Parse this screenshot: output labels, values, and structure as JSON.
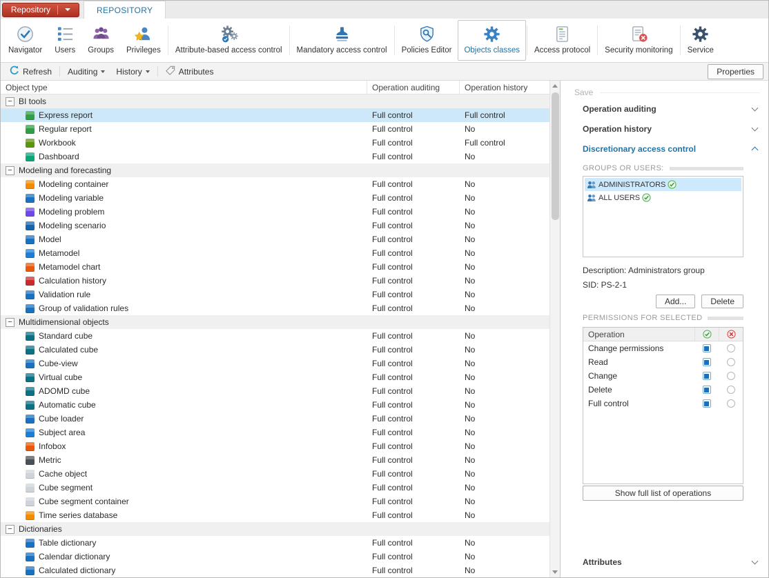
{
  "app": {
    "menu_button_label": "Repository",
    "active_tab": "REPOSITORY"
  },
  "colors": {
    "brand_red": "#b4402e",
    "accent_blue": "#2471a3",
    "selection_blue": "#cde8f9",
    "check_green": "#5cb85c",
    "cross_red": "#d9534f"
  },
  "ribbon": {
    "items": [
      {
        "label": "Navigator",
        "icon": "navigator-icon"
      },
      {
        "label": "Users",
        "icon": "users-icon"
      },
      {
        "label": "Groups",
        "icon": "groups-icon"
      },
      {
        "label": "Privileges",
        "icon": "privileges-icon"
      },
      {
        "label": "Attribute-based access control",
        "icon": "attribute-access-icon"
      },
      {
        "label": "Mandatory access control",
        "icon": "mandatory-access-icon"
      },
      {
        "label": "Policies Editor",
        "icon": "policies-editor-icon"
      },
      {
        "label": "Objects classes",
        "icon": "objects-classes-icon",
        "selected": true
      },
      {
        "label": "Access protocol",
        "icon": "access-protocol-icon"
      },
      {
        "label": "Security monitoring",
        "icon": "security-monitoring-icon"
      },
      {
        "label": "Service",
        "icon": "service-icon"
      }
    ]
  },
  "toolbar": {
    "refresh_label": "Refresh",
    "auditing_label": "Auditing",
    "history_label": "History",
    "attributes_label": "Attributes",
    "properties_label": "Properties"
  },
  "object_table": {
    "columns": [
      "Object type",
      "Operation auditing",
      "Operation history"
    ],
    "rows": [
      {
        "cls": "group",
        "label": "BI tools"
      },
      {
        "cls": "item selected",
        "label": "Express report",
        "auditing": "Full control",
        "history": "Full control",
        "icon_color": "#2f9e44"
      },
      {
        "cls": "item",
        "label": "Regular report",
        "auditing": "Full control",
        "history": "No",
        "icon_color": "#2f9e44"
      },
      {
        "cls": "item",
        "label": "Workbook",
        "auditing": "Full control",
        "history": "Full control",
        "icon_color": "#5c940d"
      },
      {
        "cls": "item",
        "label": "Dashboard",
        "auditing": "Full control",
        "history": "No",
        "icon_color": "#0ca678"
      },
      {
        "cls": "group",
        "label": "Modeling and forecasting"
      },
      {
        "cls": "item",
        "label": "Modeling container",
        "auditing": "Full control",
        "history": "No",
        "icon_color": "#f08c00"
      },
      {
        "cls": "item",
        "label": "Modeling variable",
        "auditing": "Full control",
        "history": "No",
        "icon_color": "#1971c2"
      },
      {
        "cls": "item",
        "label": "Modeling problem",
        "auditing": "Full control",
        "history": "No",
        "icon_color": "#7048e8"
      },
      {
        "cls": "item",
        "label": "Modeling scenario",
        "auditing": "Full control",
        "history": "No",
        "icon_color": "#1864ab"
      },
      {
        "cls": "item",
        "label": "Model",
        "auditing": "Full control",
        "history": "No",
        "icon_color": "#1971c2"
      },
      {
        "cls": "item",
        "label": "Metamodel",
        "auditing": "Full control",
        "history": "No",
        "icon_color": "#1c7ed6"
      },
      {
        "cls": "item",
        "label": "Metamodel chart",
        "auditing": "Full control",
        "history": "No",
        "icon_color": "#e8590c"
      },
      {
        "cls": "item",
        "label": "Calculation history",
        "auditing": "Full control",
        "history": "No",
        "icon_color": "#c92a2a"
      },
      {
        "cls": "item",
        "label": "Validation rule",
        "auditing": "Full control",
        "history": "No",
        "icon_color": "#1971c2"
      },
      {
        "cls": "item",
        "label": "Group of validation rules",
        "auditing": "Full control",
        "history": "No",
        "icon_color": "#1971c2"
      },
      {
        "cls": "group",
        "label": "Multidimensional objects"
      },
      {
        "cls": "item",
        "label": "Standard cube",
        "auditing": "Full control",
        "history": "No",
        "icon_color": "#0b7285"
      },
      {
        "cls": "item",
        "label": "Calculated cube",
        "auditing": "Full control",
        "history": "No",
        "icon_color": "#0b7285"
      },
      {
        "cls": "item",
        "label": "Cube-view",
        "auditing": "Full control",
        "history": "No",
        "icon_color": "#1971c2"
      },
      {
        "cls": "item",
        "label": "Virtual cube",
        "auditing": "Full control",
        "history": "No",
        "icon_color": "#0b7285"
      },
      {
        "cls": "item",
        "label": "ADOMD cube",
        "auditing": "Full control",
        "history": "No",
        "icon_color": "#0b7285"
      },
      {
        "cls": "item",
        "label": "Automatic cube",
        "auditing": "Full control",
        "history": "No",
        "icon_color": "#0b7285"
      },
      {
        "cls": "item",
        "label": "Cube loader",
        "auditing": "Full control",
        "history": "No",
        "icon_color": "#1971c2"
      },
      {
        "cls": "item",
        "label": "Subject area",
        "auditing": "Full control",
        "history": "No",
        "icon_color": "#1c7ed6"
      },
      {
        "cls": "item",
        "label": "Infobox",
        "auditing": "Full control",
        "history": "No",
        "icon_color": "#e8590c"
      },
      {
        "cls": "item",
        "label": "Metric",
        "auditing": "Full control",
        "history": "No",
        "icon_color": "#495057"
      },
      {
        "cls": "item",
        "label": "Cache object",
        "auditing": "Full control",
        "history": "No",
        "icon_color": "#ced4da"
      },
      {
        "cls": "item",
        "label": "Cube segment",
        "auditing": "Full control",
        "history": "No",
        "icon_color": "#ced4da"
      },
      {
        "cls": "item",
        "label": "Cube segment container",
        "auditing": "Full control",
        "history": "No",
        "icon_color": "#ced4da"
      },
      {
        "cls": "item",
        "label": "Time series database",
        "auditing": "Full control",
        "history": "No",
        "icon_color": "#f08c00"
      },
      {
        "cls": "group",
        "label": "Dictionaries"
      },
      {
        "cls": "item",
        "label": "Table dictionary",
        "auditing": "Full control",
        "history": "No",
        "icon_color": "#1971c2"
      },
      {
        "cls": "item",
        "label": "Calendar dictionary",
        "auditing": "Full control",
        "history": "No",
        "icon_color": "#1971c2"
      },
      {
        "cls": "item",
        "label": "Calculated dictionary",
        "auditing": "Full control",
        "history": "No",
        "icon_color": "#1971c2"
      }
    ]
  },
  "panel": {
    "save_label": "Save",
    "sections": [
      {
        "label": "Operation auditing",
        "state": "collapsed"
      },
      {
        "label": "Operation history",
        "state": "collapsed"
      },
      {
        "label": "Discretionary access control",
        "state": "expanded"
      }
    ],
    "groups_users": {
      "title": "GROUPS OR USERS:",
      "items": [
        {
          "label": "ADMINISTRATORS",
          "cls": "selected",
          "granted": true
        },
        {
          "label": "ALL USERS",
          "cls": "",
          "granted": true
        }
      ],
      "description": "Description: Administrators group",
      "sid": "SID: PS-2-1",
      "add_label": "Add...",
      "delete_label": "Delete"
    },
    "permissions": {
      "title": "PERMISSIONS FOR SELECTED",
      "operation_header": "Operation",
      "rows": [
        {
          "label": "Change permissions",
          "allow_cls": "checked",
          "deny_cls": ""
        },
        {
          "label": "Read",
          "allow_cls": "checked",
          "deny_cls": ""
        },
        {
          "label": "Change",
          "allow_cls": "checked",
          "deny_cls": ""
        },
        {
          "label": "Delete",
          "allow_cls": "checked",
          "deny_cls": ""
        },
        {
          "label": "Full control",
          "allow_cls": "checked",
          "deny_cls": ""
        }
      ],
      "show_full_label": "Show full list of operations"
    },
    "attributes_label": "Attributes"
  }
}
